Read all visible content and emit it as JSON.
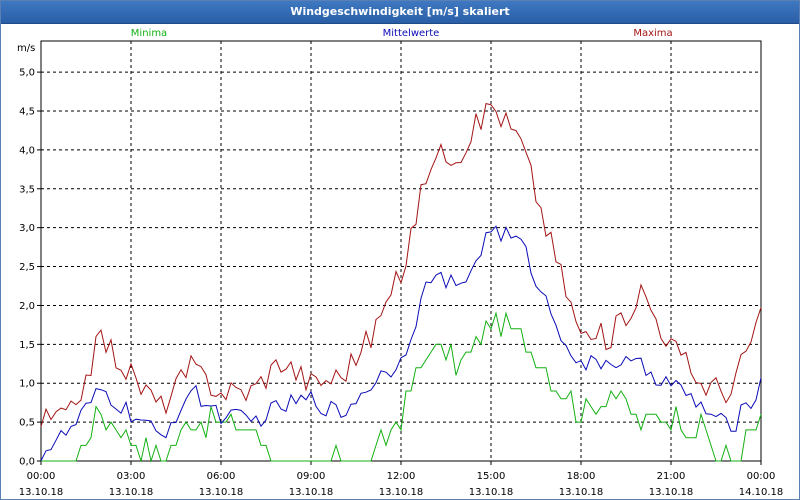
{
  "window": {
    "title": "Windgeschwindigkeit [m/s] skaliert"
  },
  "chart_data": {
    "type": "line",
    "title": "Windgeschwindigkeit [m/s] skaliert",
    "ylabel": "m/s",
    "xlabel": "",
    "ylim": [
      0,
      5.4
    ],
    "xlim": [
      0,
      24
    ],
    "grid": true,
    "legend_placement": "top",
    "yticks": [
      "0,0",
      "0,5",
      "1,0",
      "1,5",
      "2,0",
      "2,5",
      "3,0",
      "3,5",
      "4,0",
      "4,5",
      "5,0"
    ],
    "xticks": [
      {
        "time": "00:00",
        "date": "13.10.18"
      },
      {
        "time": "03:00",
        "date": "13.10.18"
      },
      {
        "time": "06:00",
        "date": "13.10.18"
      },
      {
        "time": "09:00",
        "date": "13.10.18"
      },
      {
        "time": "12:00",
        "date": "13.10.18"
      },
      {
        "time": "15:00",
        "date": "13.10.18"
      },
      {
        "time": "18:00",
        "date": "13.10.18"
      },
      {
        "time": "21:00",
        "date": "13.10.18"
      },
      {
        "time": "00:00",
        "date": "14.10.18"
      }
    ],
    "series": [
      {
        "name": "Minima",
        "color": "#13b013",
        "x": [
          0,
          1,
          2,
          3,
          4,
          5,
          6,
          7,
          8,
          9,
          10,
          11,
          12,
          13,
          14,
          15,
          16,
          17,
          18,
          19,
          20,
          21,
          22,
          23,
          24
        ],
        "values": [
          0.0,
          0.0,
          0.6,
          0.3,
          0.0,
          0.5,
          0.5,
          0.4,
          0.0,
          0.0,
          0.0,
          0.0,
          0.6,
          1.5,
          1.2,
          1.8,
          1.6,
          1.1,
          0.6,
          0.9,
          0.5,
          0.6,
          0.4,
          0.0,
          0.5
        ]
      },
      {
        "name": "Mittelwerte",
        "color": "#0b0bb8",
        "x": [
          0,
          1,
          2,
          3,
          4,
          5,
          6,
          7,
          8,
          9,
          10,
          11,
          12,
          13,
          14,
          15,
          16,
          17,
          18,
          19,
          20,
          21,
          22,
          23,
          24
        ],
        "values": [
          0.1,
          0.4,
          0.9,
          0.6,
          0.3,
          0.9,
          0.6,
          0.5,
          0.7,
          0.8,
          0.6,
          1.0,
          1.3,
          2.4,
          2.2,
          3.0,
          2.8,
          1.9,
          1.2,
          1.3,
          1.2,
          1.0,
          0.7,
          0.4,
          1.0
        ]
      },
      {
        "name": "Maxima",
        "color": "#a41414",
        "x": [
          0,
          1,
          2,
          3,
          4,
          5,
          6,
          7,
          8,
          9,
          10,
          11,
          12,
          13,
          14,
          15,
          16,
          17,
          18,
          19,
          20,
          21,
          22,
          23,
          24
        ],
        "values": [
          0.5,
          0.6,
          1.6,
          1.1,
          0.7,
          1.2,
          0.9,
          0.9,
          1.3,
          1.0,
          1.1,
          1.6,
          2.4,
          3.9,
          4.0,
          4.6,
          4.1,
          2.8,
          1.6,
          1.6,
          2.2,
          1.5,
          1.0,
          0.9,
          1.9
        ]
      }
    ]
  }
}
